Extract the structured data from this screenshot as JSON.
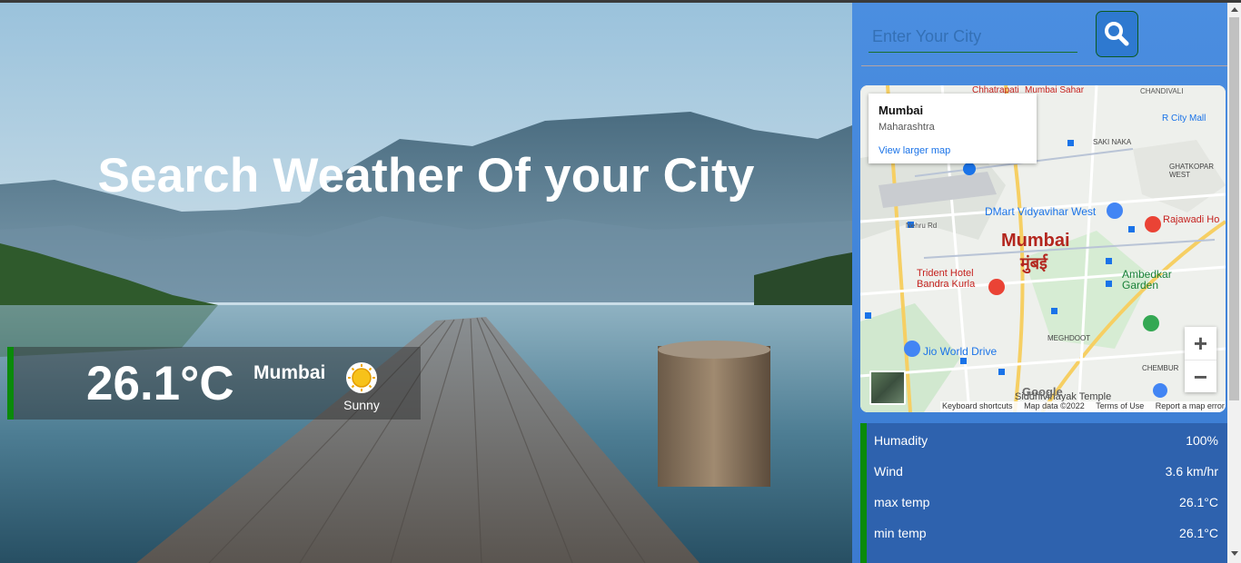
{
  "hero": {
    "title": "Search Weather Of your City"
  },
  "current": {
    "temperature": "26.1°C",
    "city": "Mumbai",
    "condition": "Sunny",
    "condition_icon": "sun-icon"
  },
  "search": {
    "placeholder": "Enter Your City",
    "button_icon": "search-icon"
  },
  "map": {
    "card_title": "Mumbai",
    "card_subtitle": "Maharashtra",
    "card_link": "View larger map",
    "city_label": "Mumbai",
    "city_label_local": "मुंबई",
    "places": [
      "Chhatrapati",
      "Mumbai Sahar",
      "CHANDIVALI",
      "R City Mall",
      "SAKI NAKA",
      "GHATKOPAR WEST",
      "DMart Vidyavihar West",
      "Rajawadi Ho",
      "Nehru Rd",
      "Trident Hotel Bandra Kurla",
      "Ambedkar Garden",
      "Jio World Drive",
      "MEGHDOOT",
      "CHEMBUR",
      "Siddhivinayak Temple"
    ],
    "zoom_in": "+",
    "zoom_out": "−",
    "footer": {
      "shortcuts": "Keyboard shortcuts",
      "data": "Map data ©2022",
      "terms": "Terms of Use",
      "report": "Report a map error"
    },
    "google": "Google"
  },
  "stats": [
    {
      "label": "Humadity",
      "value": "100%"
    },
    {
      "label": "Wind",
      "value": "3.6 km/hr"
    },
    {
      "label": "max temp",
      "value": "26.1°C"
    },
    {
      "label": "min temp",
      "value": "26.1°C"
    }
  ],
  "colors": {
    "panel_blue": "#4b8ee0",
    "accent_green": "#0a8a0a",
    "stats_blue": "#2e62ae"
  }
}
